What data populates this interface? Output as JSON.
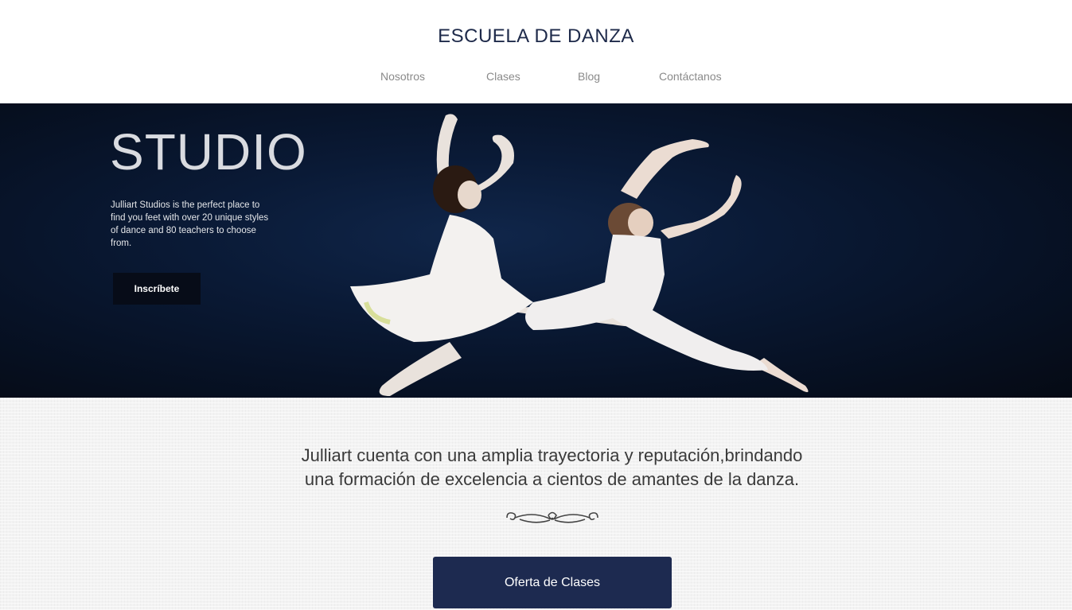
{
  "header": {
    "title": "ESCUELA DE DANZA",
    "nav": [
      "Nosotros",
      "Clases",
      "Blog",
      "Contáctanos"
    ]
  },
  "hero": {
    "title": "STUDIO",
    "description": "Julliart Studios is the perfect place to find you feet with over 20 unique styles of dance and 80 teachers to choose from.",
    "button_label": "Inscríbete"
  },
  "about": {
    "tagline_line1": "Julliart cuenta con una amplia trayectoria y reputación,brindando",
    "tagline_line2": "una formación de excelencia a cientos de amantes de la danza.",
    "cta_label": "Oferta de Clases"
  },
  "colors": {
    "title_navy": "#1e2a4a",
    "cta_navy": "#1d2a50",
    "hero_bg": "#0a1a36",
    "nav_gray": "#8a8a8a"
  }
}
